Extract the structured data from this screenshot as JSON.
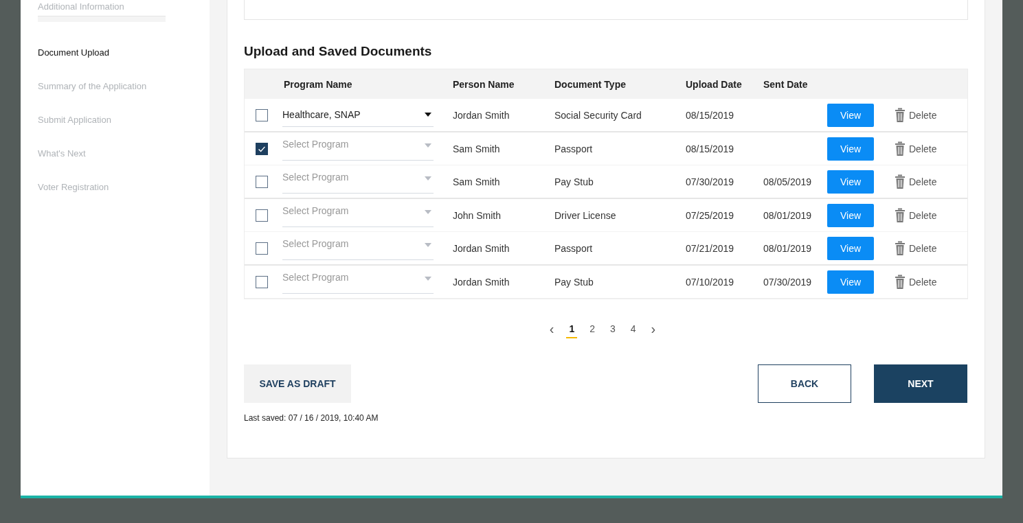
{
  "sidebar": {
    "cut_item": "Additional Information",
    "items": [
      {
        "label": "Document Upload",
        "selected": true
      },
      {
        "label": "Summary of the Application",
        "selected": false
      },
      {
        "label": "Submit Application",
        "selected": false
      },
      {
        "label": "What's Next",
        "selected": false
      },
      {
        "label": "Voter Registration",
        "selected": false
      }
    ]
  },
  "section": {
    "title": "Upload and Saved Documents"
  },
  "table": {
    "columns": [
      "Program Name",
      "Person Name",
      "Document Type",
      "Upload Date",
      "Sent Date"
    ],
    "rows": [
      {
        "checked": false,
        "program": "Healthcare, SNAP",
        "program_placeholder": false,
        "person": "Jordan Smith",
        "document_type": "Social Security Card",
        "upload_date": "08/15/2019",
        "sent_date": "",
        "view": "View",
        "delete": "Delete"
      },
      {
        "checked": true,
        "program": "Select Program",
        "program_placeholder": true,
        "person": "Sam Smith",
        "document_type": "Passport",
        "upload_date": "08/15/2019",
        "sent_date": "",
        "view": "View",
        "delete": "Delete"
      },
      {
        "checked": false,
        "program": "Select Program",
        "program_placeholder": true,
        "person": "Sam Smith",
        "document_type": "Pay Stub",
        "upload_date": "07/30/2019",
        "sent_date": "08/05/2019",
        "view": "View",
        "delete": "Delete"
      },
      {
        "checked": false,
        "program": "Select Program",
        "program_placeholder": true,
        "person": "John Smith",
        "document_type": "Driver License",
        "upload_date": "07/25/2019",
        "sent_date": "08/01/2019",
        "view": "View",
        "delete": "Delete"
      },
      {
        "checked": false,
        "program": "Select Program",
        "program_placeholder": true,
        "person": "Jordan Smith",
        "document_type": "Passport",
        "upload_date": "07/21/2019",
        "sent_date": "08/01/2019",
        "view": "View",
        "delete": "Delete"
      },
      {
        "checked": false,
        "program": "Select Program",
        "program_placeholder": true,
        "person": "Jordan Smith",
        "document_type": "Pay Stub",
        "upload_date": "07/10/2019",
        "sent_date": "07/30/2019",
        "view": "View",
        "delete": "Delete"
      }
    ]
  },
  "pagination": {
    "prev": "‹",
    "next": "›",
    "pages": [
      {
        "label": "1",
        "selected": true
      },
      {
        "label": "2",
        "selected": false
      },
      {
        "label": "3",
        "selected": false
      },
      {
        "label": "4",
        "selected": false
      }
    ]
  },
  "buttons": {
    "save_draft": "SAVE AS DRAFT",
    "back": "BACK",
    "next": "NEXT"
  },
  "last_saved": "Last saved: 07 / 16 / 2019, 10:40 AM"
}
